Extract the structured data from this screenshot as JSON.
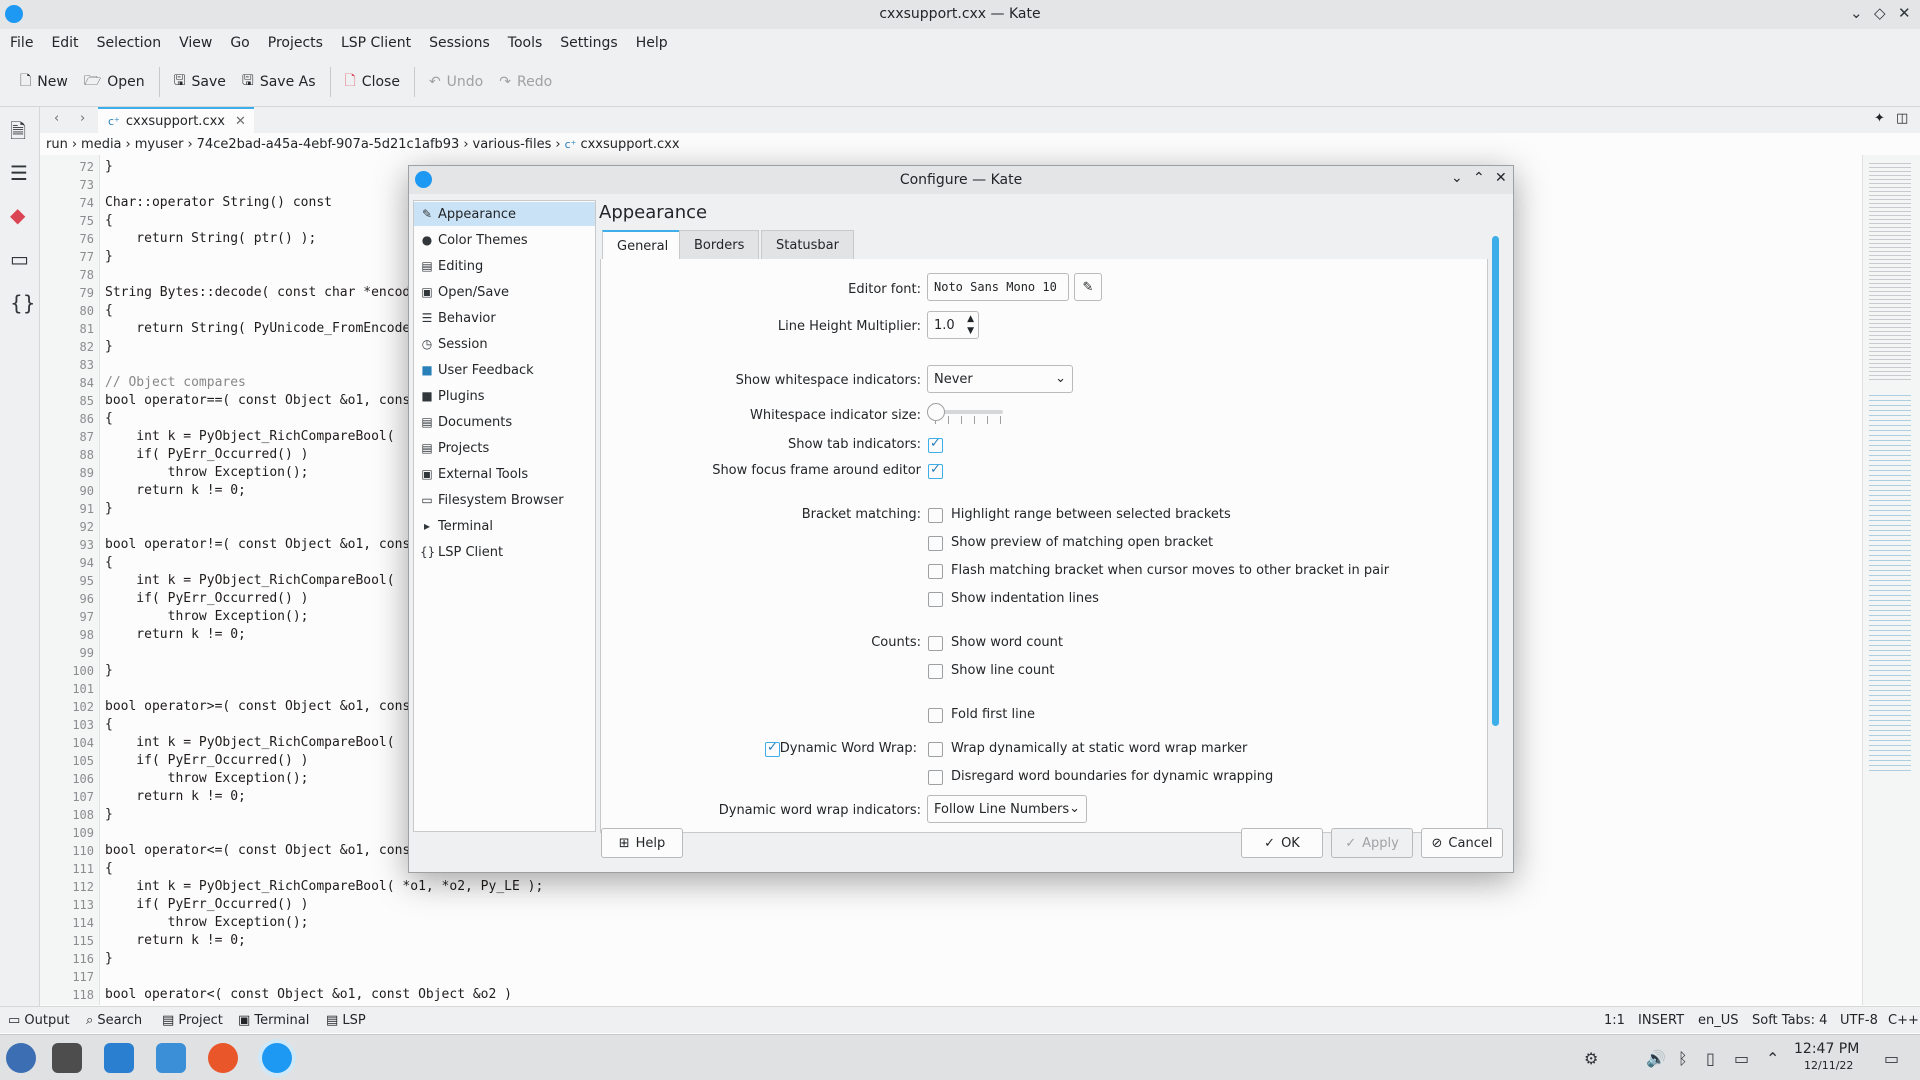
{
  "window": {
    "title": "cxxsupport.cxx — Kate"
  },
  "menu": [
    "File",
    "Edit",
    "Selection",
    "View",
    "Go",
    "Projects",
    "LSP Client",
    "Sessions",
    "Tools",
    "Settings",
    "Help"
  ],
  "toolbar": {
    "new": "New",
    "open": "Open",
    "save": "Save",
    "save_as": "Save As",
    "close": "Close",
    "undo": "Undo",
    "redo": "Redo"
  },
  "tab": {
    "filename": "cxxsupport.cxx"
  },
  "breadcrumb": [
    "run",
    "media",
    "myuser",
    "74ce2bad-a45a-4ebf-907a-5d21c1afb93",
    "various-files",
    "cxxsupport.cxx"
  ],
  "editor": {
    "lines": [
      {
        "n": "72",
        "t": "}"
      },
      {
        "n": "73",
        "t": ""
      },
      {
        "n": "74",
        "t": "Char::operator String() const"
      },
      {
        "n": "75",
        "t": "{"
      },
      {
        "n": "76",
        "t": "    return String( ptr() );"
      },
      {
        "n": "77",
        "t": "}"
      },
      {
        "n": "78",
        "t": ""
      },
      {
        "n": "79",
        "t": "String Bytes::decode( const char *encod"
      },
      {
        "n": "80",
        "t": "{"
      },
      {
        "n": "81",
        "t": "    return String( PyUnicode_FromEncode"
      },
      {
        "n": "82",
        "t": "}"
      },
      {
        "n": "83",
        "t": ""
      },
      {
        "n": "84",
        "t": "// Object compares"
      },
      {
        "n": "85",
        "t": "bool operator==( const Object &o1, cons"
      },
      {
        "n": "86",
        "t": "{"
      },
      {
        "n": "87",
        "t": "    int k = PyObject_RichCompareBool( "
      },
      {
        "n": "88",
        "t": "    if( PyErr_Occurred() )"
      },
      {
        "n": "89",
        "t": "        throw Exception();"
      },
      {
        "n": "90",
        "t": "    return k != 0;"
      },
      {
        "n": "91",
        "t": "}"
      },
      {
        "n": "92",
        "t": ""
      },
      {
        "n": "93",
        "t": "bool operator!=( const Object &o1, cons"
      },
      {
        "n": "94",
        "t": "{"
      },
      {
        "n": "95",
        "t": "    int k = PyObject_RichCompareBool( "
      },
      {
        "n": "96",
        "t": "    if( PyErr_Occurred() )"
      },
      {
        "n": "97",
        "t": "        throw Exception();"
      },
      {
        "n": "98",
        "t": "    return k != 0;"
      },
      {
        "n": "99",
        "t": ""
      },
      {
        "n": "100",
        "t": "}"
      },
      {
        "n": "101",
        "t": ""
      },
      {
        "n": "102",
        "t": "bool operator>=( const Object &o1, cons"
      },
      {
        "n": "103",
        "t": "{"
      },
      {
        "n": "104",
        "t": "    int k = PyObject_RichCompareBool( "
      },
      {
        "n": "105",
        "t": "    if( PyErr_Occurred() )"
      },
      {
        "n": "106",
        "t": "        throw Exception();"
      },
      {
        "n": "107",
        "t": "    return k != 0;"
      },
      {
        "n": "108",
        "t": "}"
      },
      {
        "n": "109",
        "t": ""
      },
      {
        "n": "110",
        "t": "bool operator<=( const Object &o1, cons"
      },
      {
        "n": "111",
        "t": "{"
      },
      {
        "n": "112",
        "t": "    int k = PyObject_RichCompareBool( *o1, *o2, Py_LE );"
      },
      {
        "n": "113",
        "t": "    if( PyErr_Occurred() )"
      },
      {
        "n": "114",
        "t": "        throw Exception();"
      },
      {
        "n": "115",
        "t": "    return k != 0;"
      },
      {
        "n": "116",
        "t": "}"
      },
      {
        "n": "117",
        "t": ""
      },
      {
        "n": "118",
        "t": "bool operator<( const Object &o1, const Object &o2 )"
      }
    ]
  },
  "statusbar": {
    "output": "Output",
    "search": "Search",
    "project": "Project",
    "terminal": "Terminal",
    "lsp": "LSP",
    "position": "1:1",
    "mode": "INSERT",
    "language": "en_US",
    "indent": "Soft Tabs: 4",
    "encoding": "UTF-8",
    "syntax": "C++"
  },
  "taskbar": {
    "time": "12:47 PM",
    "date": "12/11/22"
  },
  "dialog": {
    "title": "Configure — Kate",
    "nav": [
      "Appearance",
      "Color Themes",
      "Editing",
      "Open/Save",
      "Behavior",
      "Session",
      "User Feedback",
      "Plugins",
      "Documents",
      "Projects",
      "External Tools",
      "Filesystem Browser",
      "Terminal",
      "LSP Client"
    ],
    "page_title": "Appearance",
    "tabs": [
      "General",
      "Borders",
      "Statusbar"
    ],
    "labels": {
      "editor_font": "Editor font:",
      "line_height": "Line Height Multiplier:",
      "show_ws": "Show whitespace indicators:",
      "ws_size": "Whitespace indicator size:",
      "tab_ind": "Show tab indicators:",
      "focus_frame": "Show focus frame around editor",
      "bracket": "Bracket matching:",
      "counts": "Counts:",
      "dyn_wrap": "Dynamic Word Wrap:",
      "dyn_ind": "Dynamic word wrap indicators:"
    },
    "values": {
      "editor_font": "Noto Sans Mono 10",
      "line_height": "1.0",
      "show_ws": "Never",
      "dyn_ind": "Follow Line Numbers",
      "ws_size_level": 0
    },
    "checks": {
      "tab_ind": true,
      "focus_frame": true,
      "highlight_range": "Highlight range between selected brackets",
      "preview_open": "Show preview of matching open bracket",
      "flash_matching": "Flash matching bracket when cursor moves to other bracket in pair",
      "indent_lines": "Show indentation lines",
      "word_count": "Show word count",
      "line_count": "Show line count",
      "fold_first": "Fold first line",
      "dyn_wrap_on": true,
      "wrap_static": "Wrap dynamically at static word wrap marker",
      "disregard": "Disregard word boundaries for dynamic wrapping"
    },
    "buttons": {
      "help": "Help",
      "ok": "OK",
      "apply": "Apply",
      "cancel": "Cancel"
    }
  },
  "colors": {
    "accent": "#3daee9",
    "selection": "#c9e2f5"
  }
}
